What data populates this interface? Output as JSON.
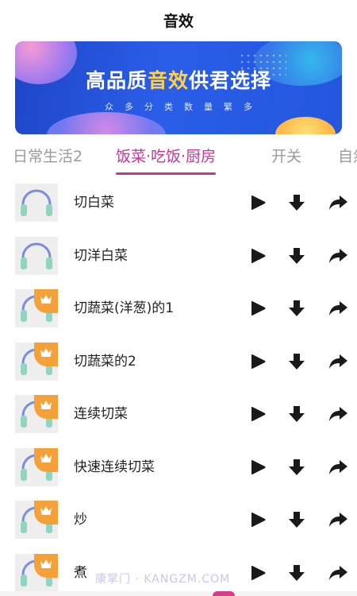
{
  "header": {
    "title": "音效"
  },
  "banner": {
    "headline_pre": "高品质",
    "headline_highlight": "音效",
    "headline_post": "供君选择",
    "tagline": "众多分类数量繁多"
  },
  "tabs": [
    {
      "label": "日常生活2",
      "active": false
    },
    {
      "label": "饭菜·吃饭·厨房",
      "active": true
    },
    {
      "label": "开关",
      "active": false
    },
    {
      "label": "自然",
      "active": false
    }
  ],
  "sounds": [
    {
      "name": "切白菜",
      "vip": false
    },
    {
      "name": "切洋白菜",
      "vip": false
    },
    {
      "name": "切蔬菜(洋葱)的1",
      "vip": true
    },
    {
      "name": "切蔬菜的2",
      "vip": true
    },
    {
      "name": "连续切菜",
      "vip": true
    },
    {
      "name": "快速连续切菜",
      "vip": true
    },
    {
      "name": "炒",
      "vip": true
    },
    {
      "name": "煮",
      "vip": true
    }
  ],
  "watermark": "康掌门 · KANGZM.COM",
  "colors": {
    "accent": "#c4349a",
    "vip_badge": "#f5a13a",
    "banner_bg": "#2456df"
  },
  "icons": {
    "play": "play-icon",
    "download": "download-icon",
    "share": "share-icon",
    "thumb": "headphones-icon",
    "badge": "crown-icon"
  }
}
